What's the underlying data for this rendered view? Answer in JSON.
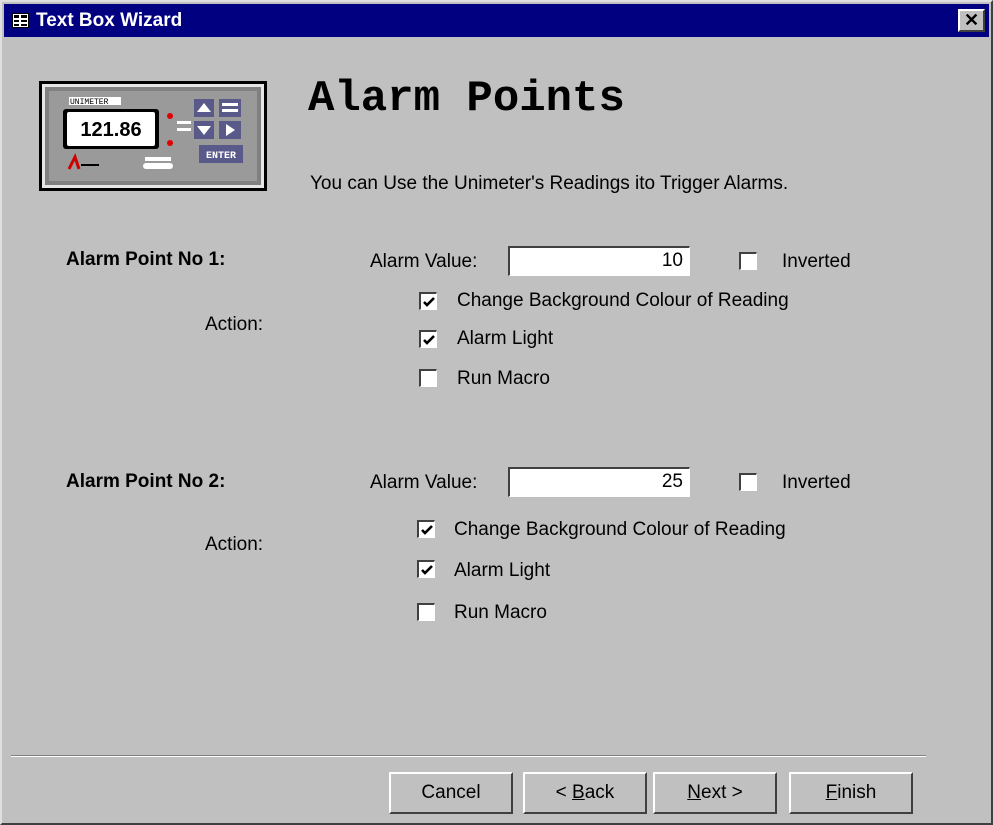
{
  "window": {
    "title": "Text Box Wizard",
    "close_symbol": "✕"
  },
  "meter": {
    "reading": "121.86",
    "header": "UNIMETER",
    "enter_label": "ENTER"
  },
  "header": {
    "title": "Alarm Points",
    "subtitle": "You can Use the Unimeter's Readings ito Trigger Alarms."
  },
  "alarm1": {
    "label": "Alarm Point No 1:",
    "value_label": "Alarm Value:",
    "value": "10",
    "inverted_label": "Inverted",
    "inverted": false,
    "action_label": "Action:",
    "change_bg_label": "Change Background Colour of Reading",
    "change_bg": true,
    "alarm_light_label": "Alarm Light",
    "alarm_light": true,
    "run_macro_label": "Run Macro",
    "run_macro": false
  },
  "alarm2": {
    "label": "Alarm Point No 2:",
    "value_label": "Alarm Value:",
    "value": "25",
    "inverted_label": "Inverted",
    "inverted": false,
    "action_label": "Action:",
    "change_bg_label": "Change Background Colour of Reading",
    "change_bg": true,
    "alarm_light_label": "Alarm Light",
    "alarm_light": true,
    "run_macro_label": "Run Macro",
    "run_macro": false
  },
  "buttons": {
    "cancel": "Cancel",
    "back_prefix": "< ",
    "back_mnemonic": "B",
    "back_rest": "ack",
    "next_mnemonic": "N",
    "next_rest": "ext >",
    "finish_mnemonic": "F",
    "finish_rest": "inish"
  }
}
